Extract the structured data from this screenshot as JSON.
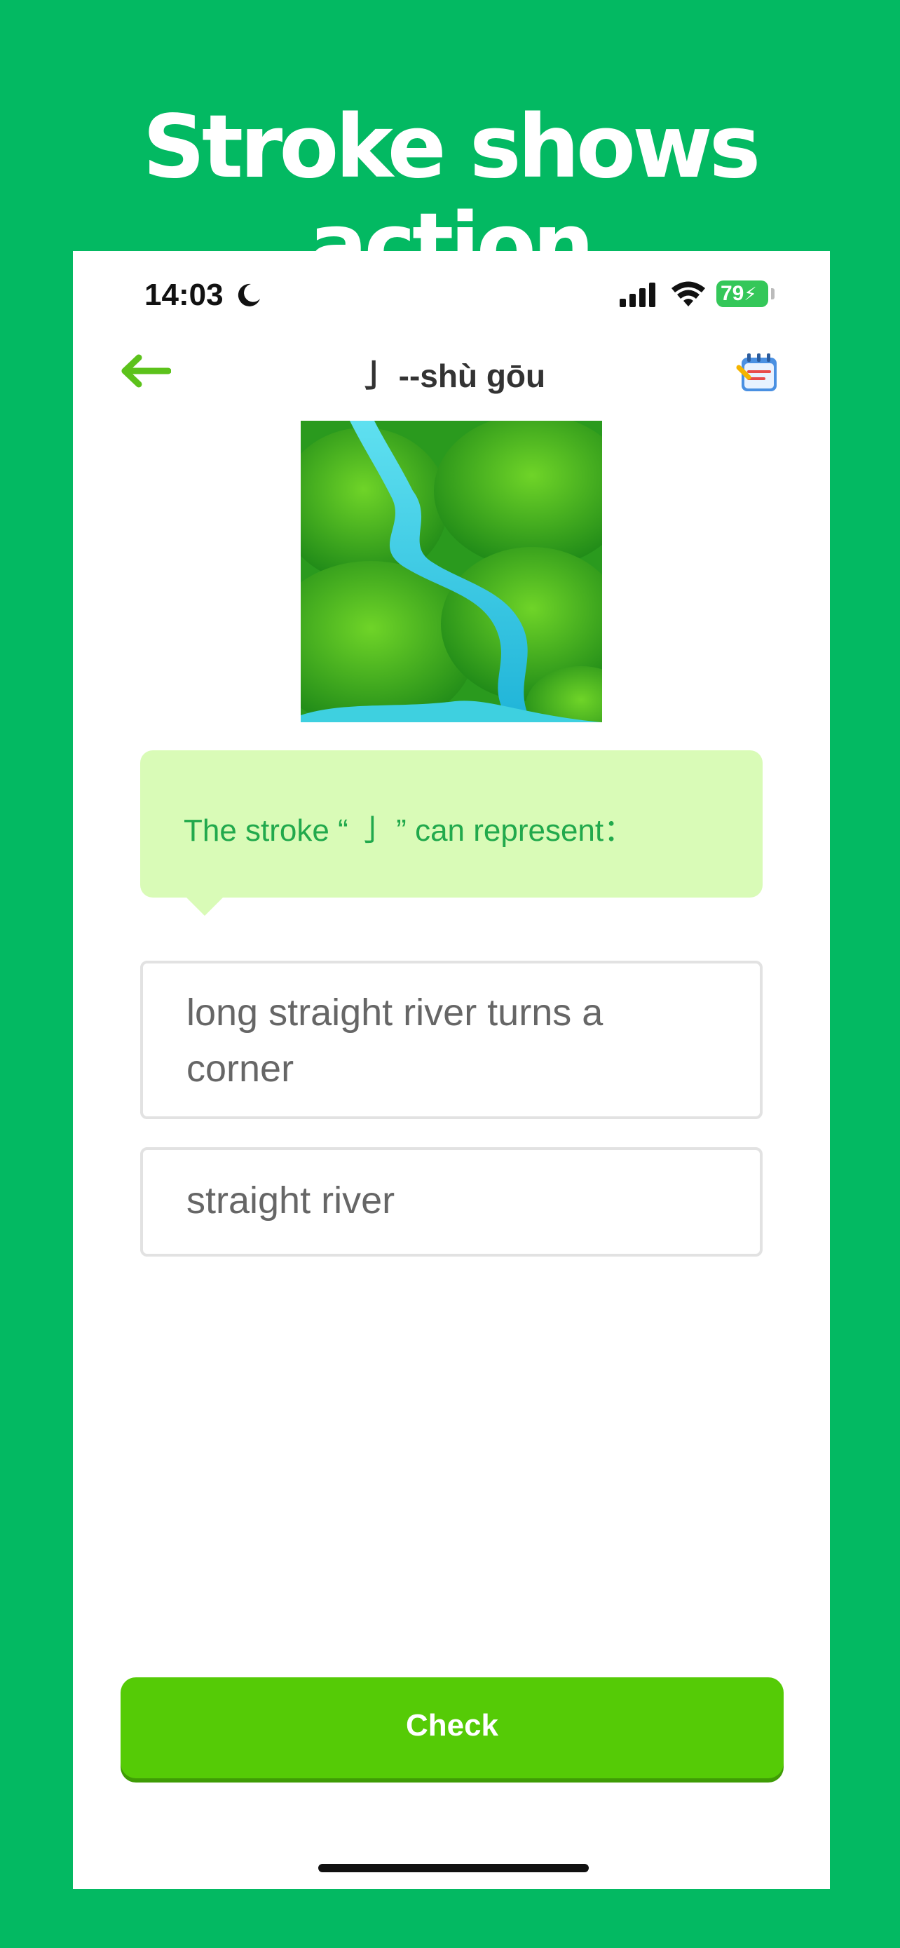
{
  "promo": {
    "title": "Stroke shows action"
  },
  "status_bar": {
    "time": "14:03",
    "battery": "79"
  },
  "header": {
    "title": "亅 --shù gōu",
    "back_icon": "back-arrow-icon",
    "notes_icon": "notes-calendar-icon"
  },
  "question": {
    "text": "The stroke “ 亅 ” can represent："
  },
  "options": [
    {
      "label": "long straight river turns a corner"
    },
    {
      "label": "straight river"
    }
  ],
  "check_button": {
    "label": "Check"
  },
  "colors": {
    "background": "#03b962",
    "accent_green": "#55cb06",
    "bubble": "#d9fbb7",
    "question_text": "#21a94c"
  }
}
